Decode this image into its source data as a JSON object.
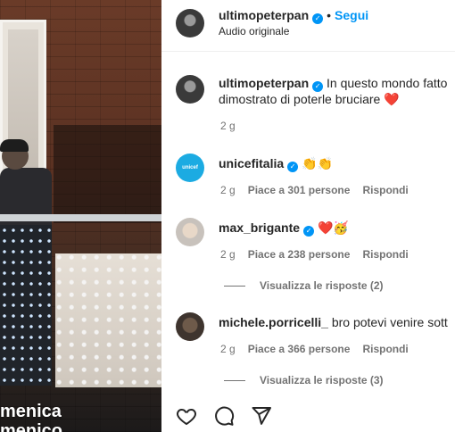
{
  "media": {
    "caption_line1": "menica",
    "caption_line2": "menico"
  },
  "post_header": {
    "username": "ultimopeterpan",
    "separator": "•",
    "follow_label": "Segui",
    "audio_label": "Audio originale"
  },
  "caption": {
    "username": "ultimopeterpan",
    "text_line1": "In questo mondo fatto",
    "text_line2": "dimostrato di poterle bruciare ❤️",
    "time": "2 g"
  },
  "comments": [
    {
      "username": "unicefitalia",
      "text": "👏👏",
      "time": "2 g",
      "likes": "Piace a 301 persone",
      "reply_label": "Rispondi",
      "avatar_text": "unicef"
    },
    {
      "username": "max_brigante",
      "text": "❤️🥳",
      "time": "2 g",
      "likes": "Piace a 238 persone",
      "reply_label": "Rispondi",
      "view_replies": "Visualizza le risposte (2)"
    },
    {
      "username": "michele.porricelli_",
      "text": "bro potevi venire sott",
      "time": "2 g",
      "likes": "Piace a 366 persone",
      "reply_label": "Rispondi",
      "view_replies": "Visualizza le risposte (3)"
    }
  ],
  "icons": {
    "like": "heart-icon",
    "comment": "comment-icon",
    "share": "share-icon",
    "verified": "verified-badge-icon"
  },
  "colors": {
    "accent_blue": "#0095f6",
    "heart_red": "#e0245e",
    "muted_text": "#737373",
    "primary_text": "#262626"
  }
}
